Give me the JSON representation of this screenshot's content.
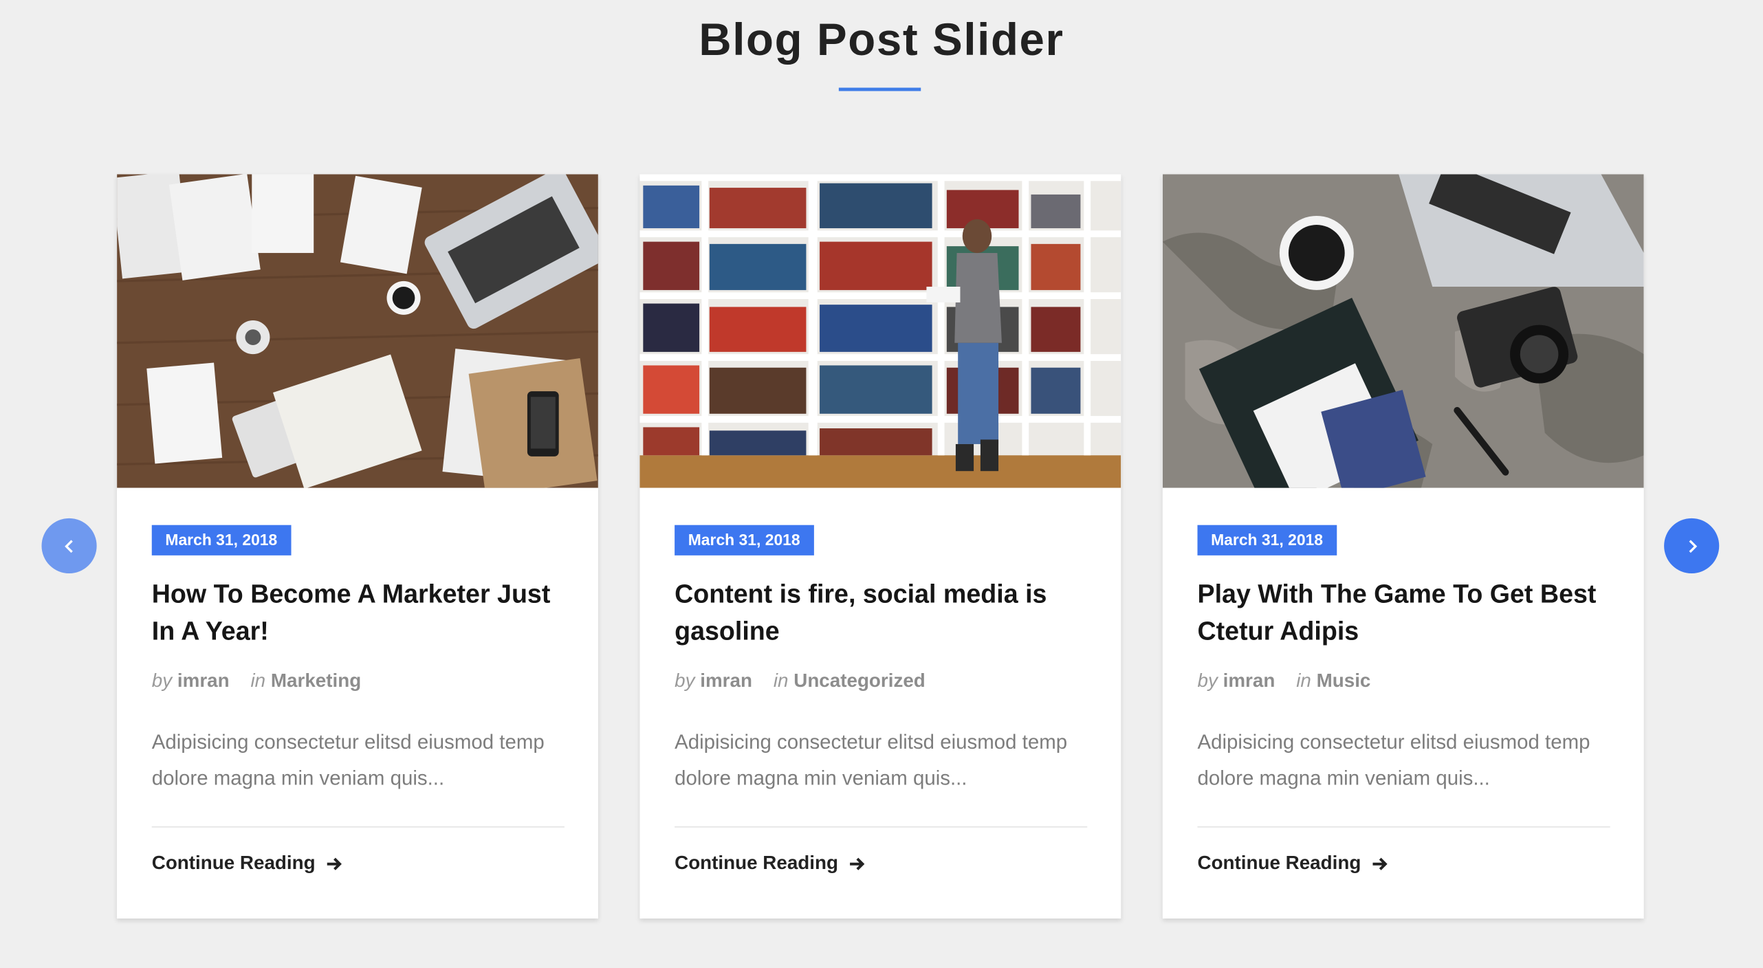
{
  "section": {
    "title": "Blog Post Slider"
  },
  "colors": {
    "accent": "#3d77f0",
    "background": "#efefef"
  },
  "navigation": {
    "prev_icon": "chevron-left-icon",
    "next_icon": "chevron-right-icon"
  },
  "posts": [
    {
      "image": "desk-workspace-image",
      "date": "March 31, 2018",
      "title": "How To Become A Marketer Just In A Year!",
      "by_label": "by",
      "author": "imran",
      "in_label": "in",
      "category": "Marketing",
      "excerpt": "Adipisicing consectetur elitsd eiusmod temp dolore magna min veniam quis...",
      "cta": "Continue Reading"
    },
    {
      "image": "library-bookshelf-image",
      "date": "March 31, 2018",
      "title": "Content is fire, social media is gasoline",
      "by_label": "by",
      "author": "imran",
      "in_label": "in",
      "category": "Uncategorized",
      "excerpt": "Adipisicing consectetur elitsd eiusmod temp dolore magna min veniam quis...",
      "cta": "Continue Reading"
    },
    {
      "image": "travel-map-camera-image",
      "date": "March 31, 2018",
      "title": "Play With The Game To Get Best Ctetur Adipis",
      "by_label": "by",
      "author": "imran",
      "in_label": "in",
      "category": "Music",
      "excerpt": "Adipisicing consectetur elitsd eiusmod temp dolore magna min veniam quis...",
      "cta": "Continue Reading"
    }
  ]
}
